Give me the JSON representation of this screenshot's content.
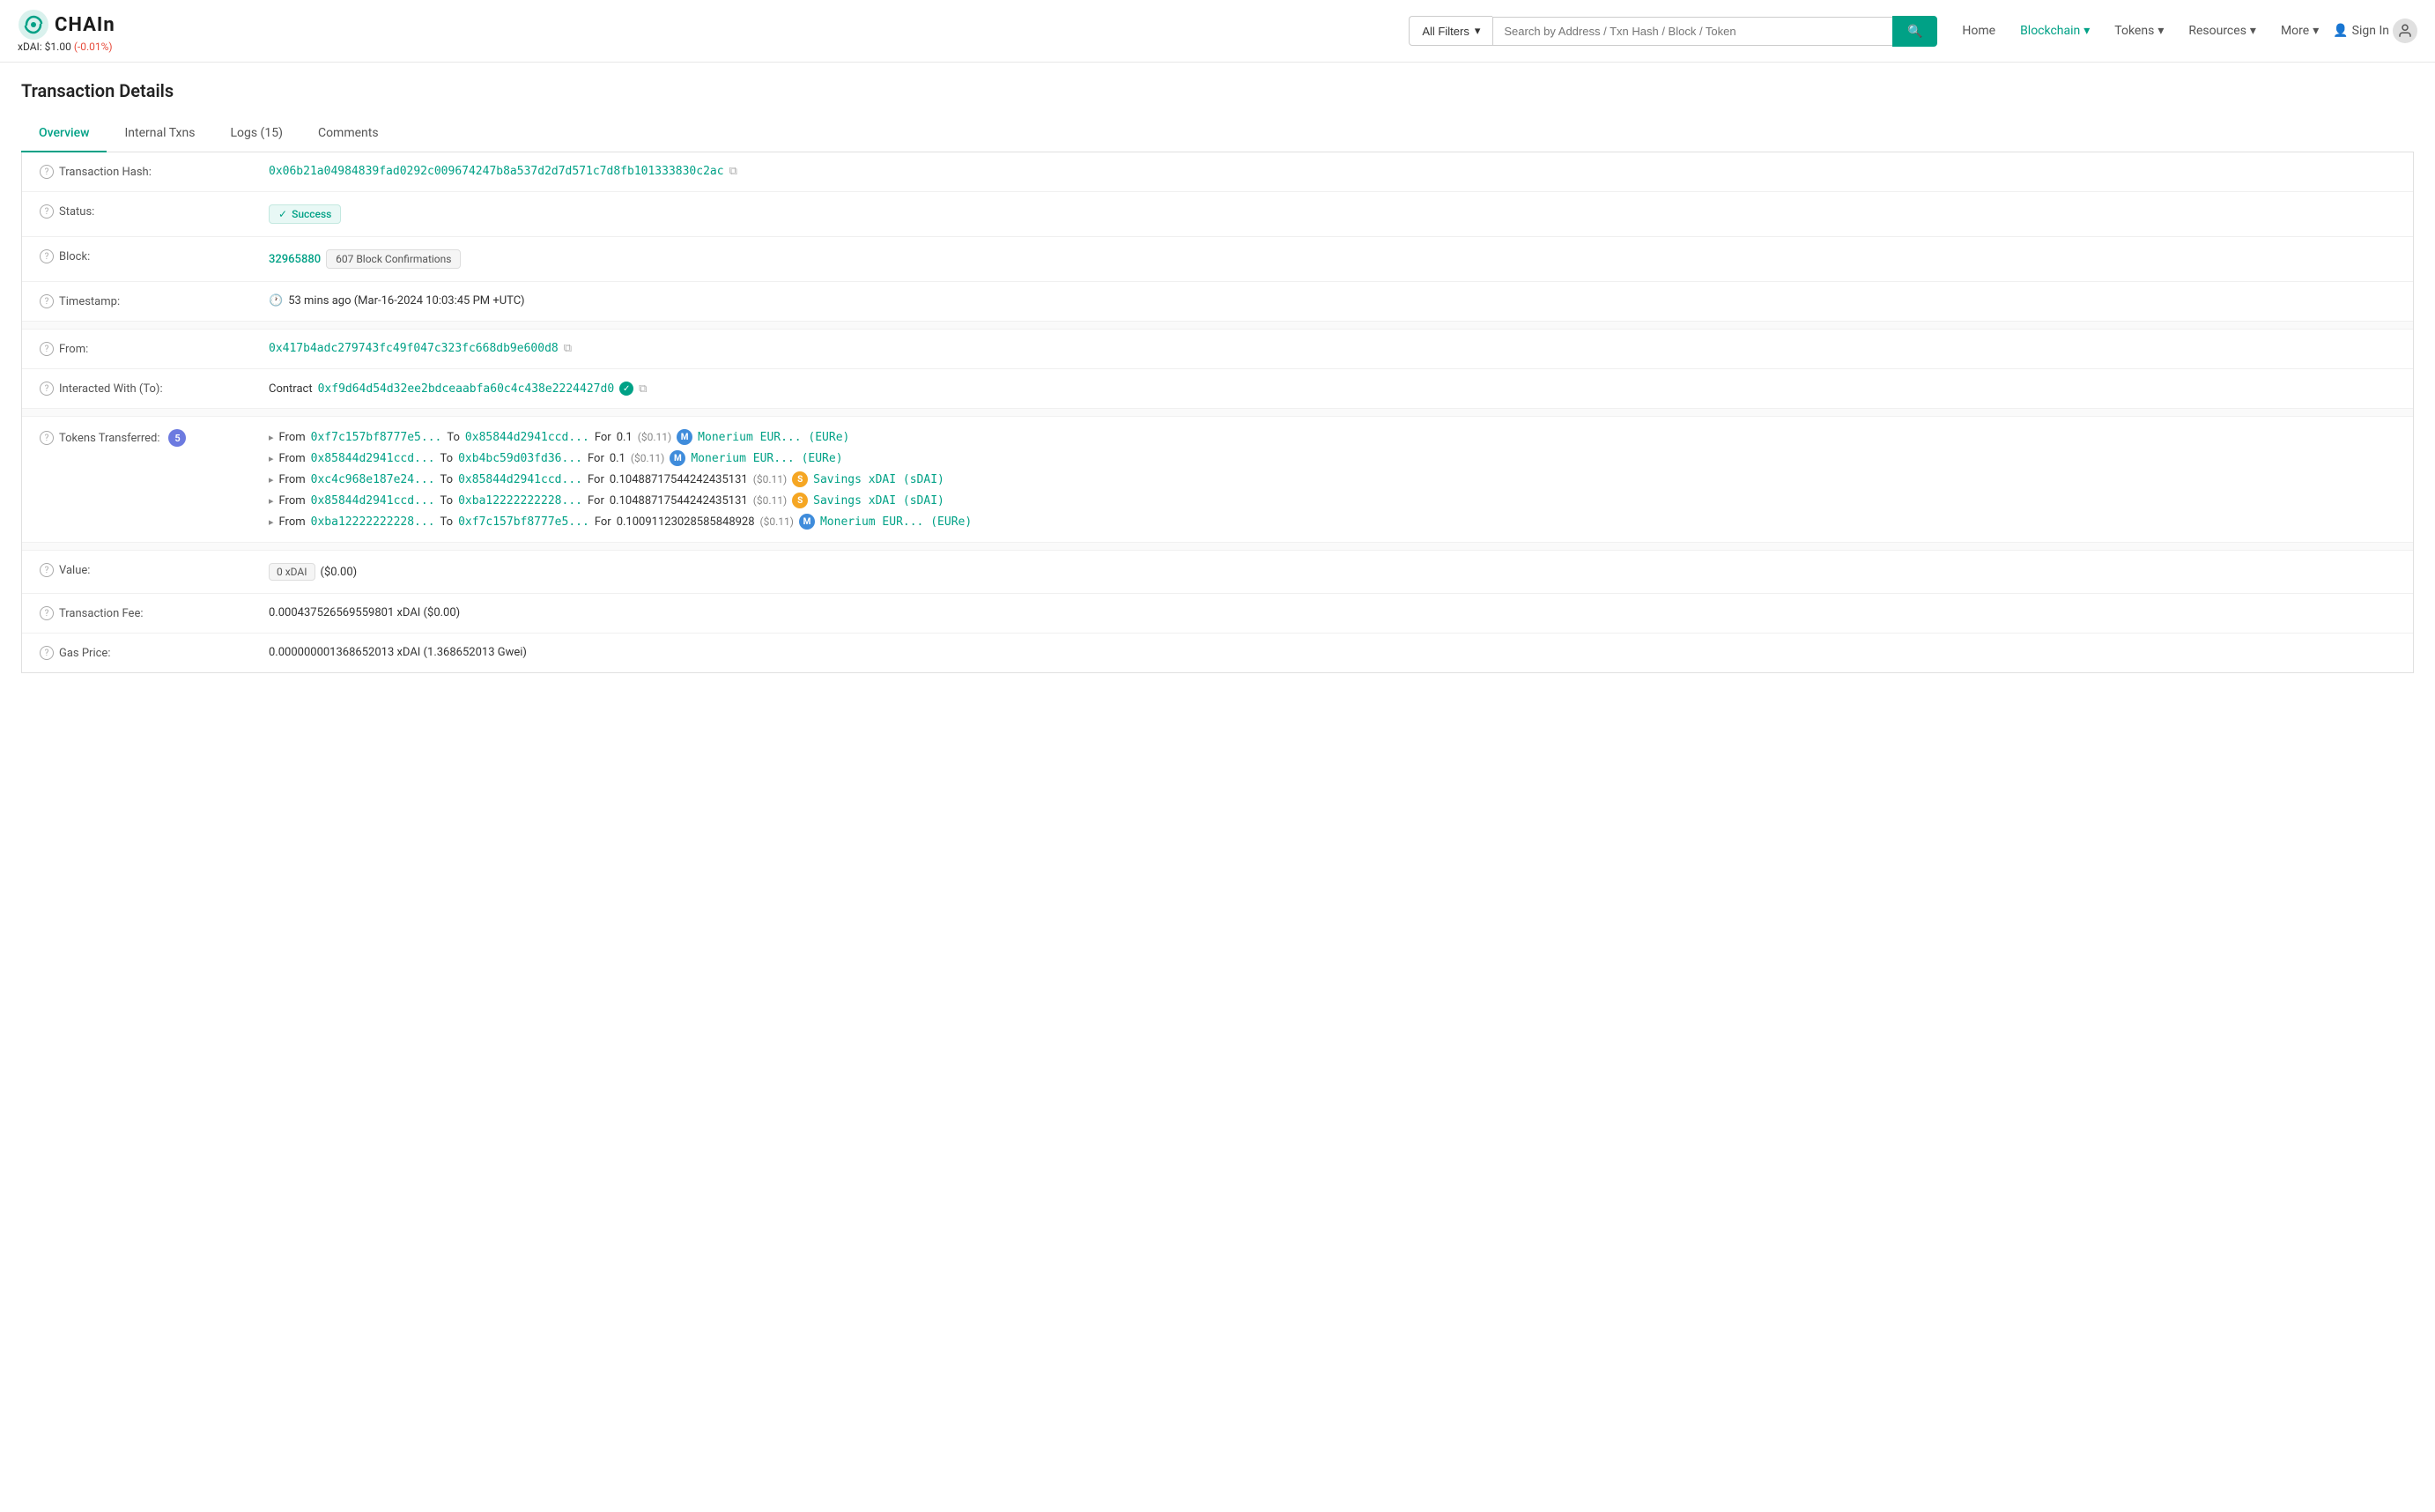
{
  "header": {
    "logo_text": "CHAIn",
    "price_label": "xDAI: $1.00",
    "price_change": "(-0.01%)",
    "filter_label": "All Filters",
    "search_placeholder": "Search by Address / Txn Hash / Block / Token",
    "nav": [
      {
        "label": "Home",
        "active": false
      },
      {
        "label": "Blockchain",
        "active": true,
        "dropdown": true
      },
      {
        "label": "Tokens",
        "active": false,
        "dropdown": true
      },
      {
        "label": "Resources",
        "active": false,
        "dropdown": true
      },
      {
        "label": "More",
        "active": false,
        "dropdown": true
      }
    ],
    "sign_in_label": "Sign In"
  },
  "page": {
    "title": "Transaction Details"
  },
  "tabs": [
    {
      "label": "Overview",
      "active": true
    },
    {
      "label": "Internal Txns",
      "active": false
    },
    {
      "label": "Logs (15)",
      "active": false
    },
    {
      "label": "Comments",
      "active": false
    }
  ],
  "details": {
    "tx_hash_label": "Transaction Hash:",
    "tx_hash_value": "0x06b21a04984839fad0292c009674247b8a537d2d7d571c7d8fb101333830c2ac",
    "status_label": "Status:",
    "status_value": "Success",
    "block_label": "Block:",
    "block_value": "32965880",
    "confirmations_label": "607 Block Confirmations",
    "timestamp_label": "Timestamp:",
    "timestamp_value": "53 mins ago (Mar-16-2024 10:03:45 PM +UTC)",
    "from_label": "From:",
    "from_value": "0x417b4adc279743fc49f047c323fc668db9e600d8",
    "interacted_label": "Interacted With (To):",
    "interacted_prefix": "Contract",
    "interacted_value": "0xf9d64d54d32ee2bdceaabfa60c4c438e2224427d0",
    "tokens_label": "Tokens Transferred:",
    "tokens_count": "5",
    "tokens": [
      {
        "from": "0xf7c157bf8777e5...",
        "to": "0x85844d2941ccd...",
        "amount": "0.1",
        "usd": "($0.11)",
        "token_name": "Monerium EUR... (EURe)",
        "token_type": "monerium"
      },
      {
        "from": "0x85844d2941ccd...",
        "to": "0xb4bc59d03fd36...",
        "amount": "0.1",
        "usd": "($0.11)",
        "token_name": "Monerium EUR... (EURe)",
        "token_type": "monerium"
      },
      {
        "from": "0xc4c968e187e24...",
        "to": "0x85844d2941ccd...",
        "amount": "0.10488717544242435131",
        "usd": "($0.11)",
        "token_name": "Savings xDAI (sDAI)",
        "token_type": "savings"
      },
      {
        "from": "0x85844d2941ccd...",
        "to": "0xba12222222228...",
        "amount": "0.10488717544242435131",
        "usd": "($0.11)",
        "token_name": "Savings xDAI (sDAI)",
        "token_type": "savings"
      },
      {
        "from": "0xba12222222228...",
        "to": "0xf7c157bf8777e5...",
        "amount": "0.10091123028585848928",
        "usd": "($0.11)",
        "token_name": "Monerium EUR... (EURe)",
        "token_type": "monerium"
      }
    ],
    "value_label": "Value:",
    "value_amount": "0 xDAI",
    "value_usd": "($0.00)",
    "fee_label": "Transaction Fee:",
    "fee_value": "0.000437526569559801 xDAI ($0.00)",
    "gas_label": "Gas Price:",
    "gas_value": "0.000000001368652013 xDAI (1.368652013 Gwei)"
  }
}
